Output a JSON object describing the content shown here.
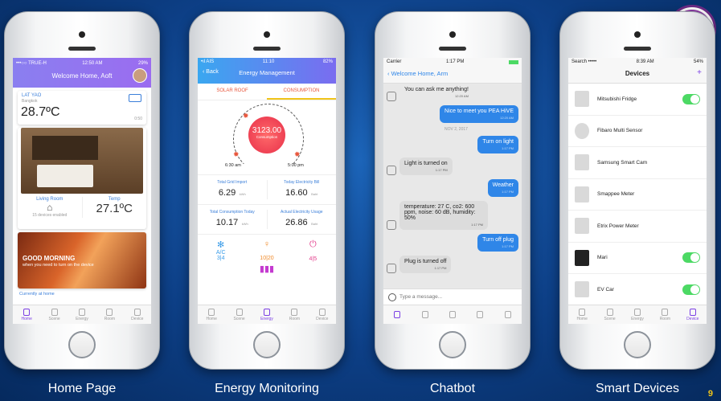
{
  "page_number": "9",
  "captions": [
    "Home Page",
    "Energy Monitoring",
    "Chatbot",
    "Smart Devices"
  ],
  "tabs": [
    "Home",
    "Scene",
    "Energy",
    "Room",
    "Device"
  ],
  "home": {
    "status": {
      "carrier": "•••○○ TRUE-H",
      "time": "12:50 AM",
      "battery": "29%"
    },
    "title": "Welcome Home, Aoft",
    "location": "LAT YAO",
    "city": "Bangkok",
    "temp": "28.7ºC",
    "update": "0:50",
    "room": "Living Room",
    "devices": "15 devices enabled",
    "temp_label": "Temp",
    "room_temp": "27.1ºC",
    "banner_title": "GOOD MORNING",
    "banner_sub": "when you need to turn on the device",
    "currently": "Currently at home"
  },
  "energy": {
    "status": {
      "carrier": "•ıl AIS",
      "time": "11:10",
      "battery": "82%"
    },
    "back": "Back",
    "title": "Energy Management",
    "seg1": "SOLAR ROOF",
    "seg2": "CONSUMPTION",
    "value": "3123.00",
    "value_label": "Consumption",
    "t1": "6:30 am",
    "t2": "5:00 pm",
    "stats": [
      {
        "l": "Total Grid Import",
        "v": "6.29",
        "u": "kWh"
      },
      {
        "l": "Today Electricity Bill",
        "v": "16.60",
        "u": "Baht"
      },
      {
        "l": "Total Consumption Today",
        "v": "10.17",
        "u": "kWh"
      },
      {
        "l": "Actual Electricity Usage",
        "v": "26.86",
        "u": "Baht"
      }
    ],
    "icons": [
      {
        "l": "A/C",
        "v": "3|4"
      },
      {
        "l": "",
        "v": "10|20"
      },
      {
        "l": "",
        "v": "4|5"
      }
    ]
  },
  "chat": {
    "status": {
      "carrier": "Carrier",
      "time": "1:17 PM"
    },
    "back": "Welcome Home, Arm",
    "m0": "You can ask me anything!",
    "m0t": "12:20 AM",
    "m1": "Nice to meet you PEA HiVE",
    "m1t": "12:20 AM",
    "date": "NOV 2, 2017",
    "m2": "Turn on light",
    "m2t": "1:17 PM",
    "m3": "Light is turned on",
    "m3t": "1:17 PM",
    "m4": "Weather",
    "m4t": "1:17 PM",
    "m5": "temperature: 27 C, co2: 600 ppm, noise: 60 dB, humidity: 50%",
    "m5t": "1:17 PM",
    "m6": "Turn off plug",
    "m6t": "1:17 PM",
    "m7": "Plug is turned off",
    "m7t": "1:17 PM",
    "placeholder": "Type a message..."
  },
  "devices": {
    "status": {
      "carrier": "Search •••••",
      "time": "8:39 AM",
      "battery": "54%"
    },
    "title": "Devices",
    "add": "+",
    "items": [
      {
        "name": "Mitsubishi Fridge",
        "toggle": true
      },
      {
        "name": "Fibaro Multi Sensor",
        "toggle": false
      },
      {
        "name": "Samsung Smart Cam",
        "toggle": false
      },
      {
        "name": "Smappee Meter",
        "toggle": false
      },
      {
        "name": "Etrix Power Meter",
        "toggle": false
      },
      {
        "name": "Mari",
        "toggle": true
      },
      {
        "name": "EV Car",
        "toggle": true
      }
    ]
  }
}
